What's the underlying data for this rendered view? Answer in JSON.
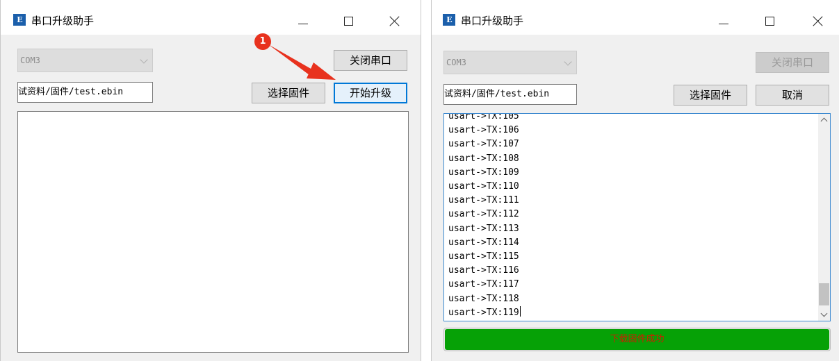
{
  "left_window": {
    "title": "串口升级助手",
    "app_icon": "E",
    "port_combo": "COM3",
    "close_port_button": "关闭串口",
    "file_path": "试资料/固件/test.ebin",
    "select_firmware_button": "选择固件",
    "start_upgrade_button": "开始升级",
    "annotation_badge": "1"
  },
  "right_window": {
    "title": "串口升级助手",
    "app_icon": "E",
    "port_combo": "COM3",
    "close_port_button": "关闭串口",
    "file_path": "试资料/固件/test.ebin",
    "select_firmware_button": "选择固件",
    "cancel_button": "取消",
    "log_partial_top": "usart->TX:105",
    "log_lines": [
      "usart->TX:106",
      "usart->TX:107",
      "usart->TX:108",
      "usart->TX:109",
      "usart->TX:110",
      "usart->TX:111",
      "usart->TX:112",
      "usart->TX:113",
      "usart->TX:114",
      "usart->TX:115",
      "usart->TX:116",
      "usart->TX:117",
      "usart->TX:118",
      "usart->TX:119"
    ],
    "progress_percent": 100,
    "progress_text": "下载固件成功"
  },
  "colors": {
    "accent_focus": "#0078d7",
    "progress_green": "#06a106",
    "annotation_red": "#e8321e",
    "status_text_red": "#cc1f00"
  },
  "icons": [
    "app-logo-icon",
    "minimize-icon",
    "maximize-icon",
    "close-icon",
    "dropdown-arrow-icon",
    "scroll-up-icon",
    "scroll-down-icon",
    "annotation-arrow-icon"
  ]
}
